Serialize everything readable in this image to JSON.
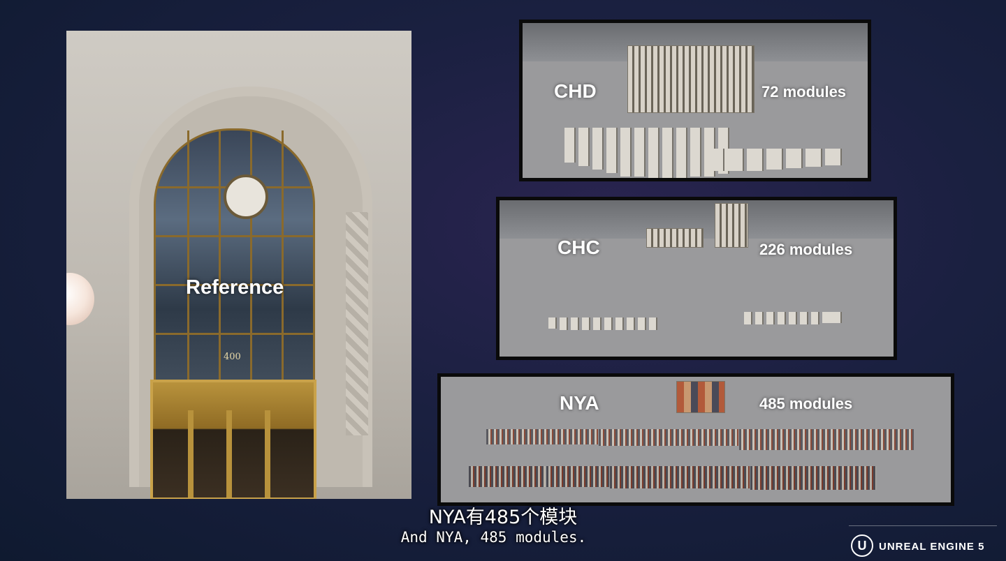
{
  "reference": {
    "label": "Reference",
    "address": "400"
  },
  "panels": {
    "chd": {
      "label": "CHD",
      "count": "72 modules"
    },
    "chc": {
      "label": "CHC",
      "count": "226 modules"
    },
    "nya": {
      "label": "NYA",
      "count": "485 modules"
    }
  },
  "subtitles": {
    "zh": "NYA有485个模块",
    "en": "And NYA, 485 modules."
  },
  "branding": {
    "logo_glyph": "U",
    "name": "UNREAL ENGINE 5"
  }
}
